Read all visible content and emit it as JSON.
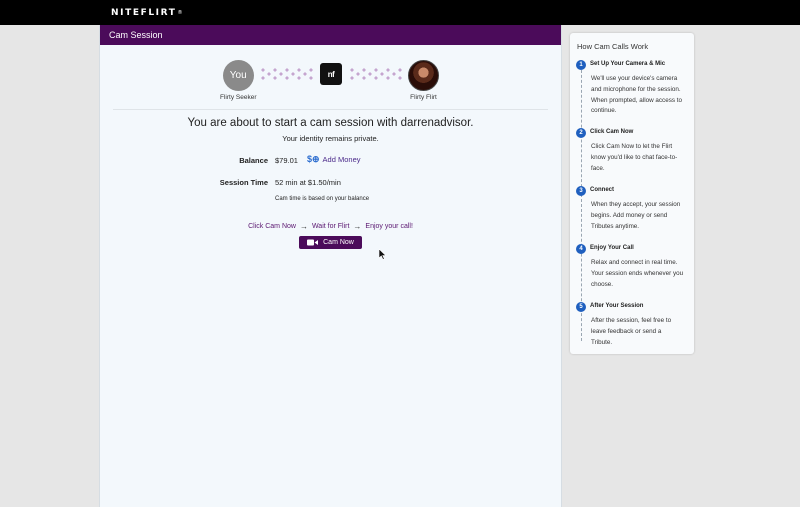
{
  "brand": {
    "logo_text": "NITEFLIRT",
    "logo_mark": "®"
  },
  "session": {
    "header_title": "Cam Session",
    "you_initials": "You",
    "you_caption": "Flirty Seeker",
    "nf_mark": "nf",
    "flirt_caption": "Flirty Flirt",
    "headline": "You are about to start a cam session with darrenadvisor.",
    "subline": "Your identity remains private.",
    "balance_label": "Balance",
    "balance_value": "$79.01",
    "add_money_label": "Add Money",
    "session_time_label": "Session Time",
    "session_time_value": "52 min at $1.50/min",
    "note": "Cam time is based on your balance",
    "steps": [
      "Click Cam Now",
      "Wait for Flirt",
      "Enjoy your call!"
    ],
    "cam_now_label": "Cam Now"
  },
  "how_it_works": {
    "title": "How Cam Calls Work",
    "steps": [
      {
        "num": "1",
        "title": "Set Up Your Camera & Mic",
        "desc": "We'll use your device's camera and microphone for the session. When prompted, allow access to continue."
      },
      {
        "num": "2",
        "title": "Click Cam Now",
        "desc": "Click Cam Now to let the Flirt know you'd like to chat face-to-face."
      },
      {
        "num": "3",
        "title": "Connect",
        "desc": "When they accept, your session begins. Add money or send Tributes anytime."
      },
      {
        "num": "4",
        "title": "Enjoy Your Call",
        "desc": "Relax and connect in real time. Your session ends whenever you choose."
      },
      {
        "num": "5",
        "title": "After Your Session",
        "desc": "After the session, feel free to leave feedback or send a Tribute."
      }
    ]
  },
  "colors": {
    "brand_purple": "#4b0b5a",
    "step_blue": "#1f5fbf",
    "link_blue": "#2a6ccf"
  }
}
